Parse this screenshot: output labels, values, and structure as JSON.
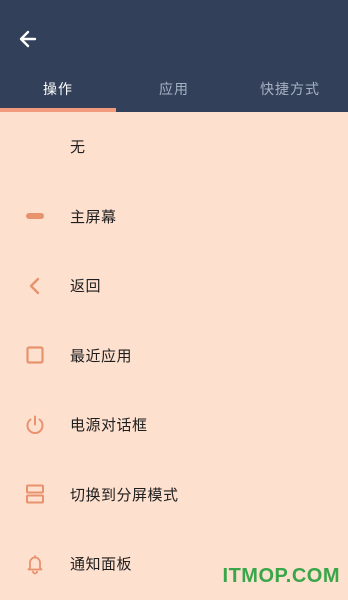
{
  "colors": {
    "header_bg": "#324059",
    "content_bg": "#fee0cf",
    "accent": "#f29c7d",
    "icon": "#e8926e",
    "tab_inactive": "#a6b1c3",
    "watermark": "#3aa64a"
  },
  "header": {
    "back_icon": "arrow-left-icon"
  },
  "tabs": [
    {
      "label": "操作",
      "active": true
    },
    {
      "label": "应用",
      "active": false
    },
    {
      "label": "快捷方式",
      "active": false
    }
  ],
  "items": [
    {
      "label": "无",
      "icon": "none"
    },
    {
      "label": "主屏幕",
      "icon": "home-bar-icon"
    },
    {
      "label": "返回",
      "icon": "chevron-left-icon"
    },
    {
      "label": "最近应用",
      "icon": "square-icon"
    },
    {
      "label": "电源对话框",
      "icon": "power-icon"
    },
    {
      "label": "切换到分屏模式",
      "icon": "split-screen-icon"
    },
    {
      "label": "通知面板",
      "icon": "bell-icon"
    }
  ],
  "watermark": "ITMOP.COM"
}
